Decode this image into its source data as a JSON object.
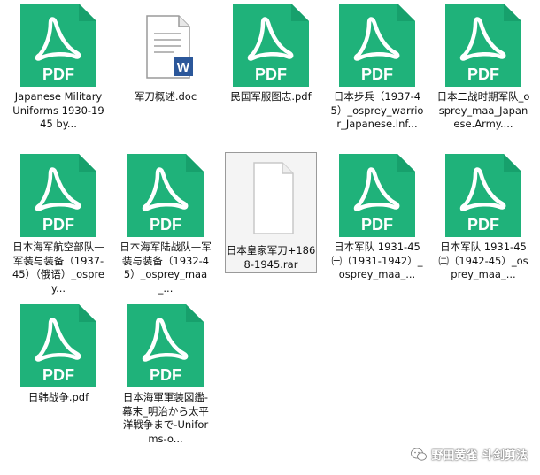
{
  "files": [
    {
      "name": "Japanese Military Uniforms 1930-1945 by...",
      "type": "pdf"
    },
    {
      "name": "军刀概述.doc",
      "type": "doc"
    },
    {
      "name": "民国军服图志.pdf",
      "type": "pdf"
    },
    {
      "name": "日本步兵（1937-45）_osprey_warrior_Japanese.Inf...",
      "type": "pdf"
    },
    {
      "name": "日本二战时期军队_osprey_maa_Japanese.Army....",
      "type": "pdf"
    },
    {
      "name": "日本海军航空部队—军装与装备（1937-45）（俄语）_osprey...",
      "type": "pdf"
    },
    {
      "name": "日本海军陆战队—军装与装备（1932-45）_osprey_maa_...",
      "type": "pdf"
    },
    {
      "name": "日本皇家军刀+1868-1945.rar",
      "type": "rar"
    },
    {
      "name": "日本军队 1931-45㈠（1931-1942）_osprey_maa_...",
      "type": "pdf"
    },
    {
      "name": "日本军队 1931-45㈡（1942-45）_osprey_maa_...",
      "type": "pdf"
    },
    {
      "name": "日韩战争.pdf",
      "type": "pdf"
    },
    {
      "name": "日本海軍軍装図鑑-幕末_明治から太平洋戦争まで-Uniforms-o...",
      "type": "pdf"
    }
  ],
  "icon_text": {
    "pdf": "PDF",
    "word_badge": "W"
  },
  "colors": {
    "pdf_green": "#1fb27a",
    "pdf_dark": "#17a06c",
    "word_blue": "#2b579a"
  },
  "watermark": {
    "text": "野田黄雀 斗剑剪法",
    "icon": "wechat-icon"
  }
}
